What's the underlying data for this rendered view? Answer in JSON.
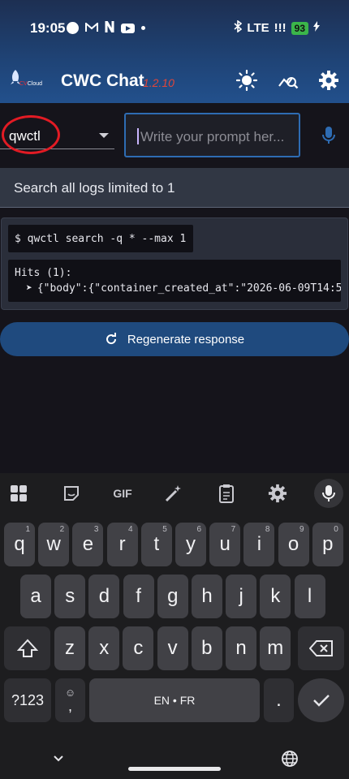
{
  "status": {
    "time": "19:05",
    "network": "LTE",
    "signal_glyph": "!!!",
    "battery": "93",
    "icons": [
      "circle-icon",
      "gmail-icon",
      "netflix-icon",
      "youtube-icon",
      "dot-icon",
      "bluetooth-icon",
      "charging-icon"
    ]
  },
  "appbar": {
    "logo_text_red": "CV",
    "logo_text": "Cloud",
    "title": "CWC Chat",
    "version": "1.2.10",
    "icons": [
      "theme-sun-icon",
      "analytics-icon",
      "settings-gear-icon"
    ]
  },
  "selector": {
    "value": "qwctl"
  },
  "prompt": {
    "placeholder": "Write your prompt her..."
  },
  "suggestion": {
    "text": "Search all logs limited to 1"
  },
  "response": {
    "command": "$ qwctl search -q * --max 1",
    "output_line1": "Hits (1):",
    "output_arrow": "➤",
    "output_line2": "{\"body\":{\"container_created_at\":\"2026-06-09T14:5"
  },
  "regenerate": {
    "label": "Regenerate response"
  },
  "keyboard": {
    "toolbar": [
      "apps-grid-icon",
      "sticker-icon",
      "GIF",
      "magic-wand-icon",
      "clipboard-icon",
      "settings-gear-icon",
      "mic-icon"
    ],
    "gif_label": "GIF",
    "row1": [
      {
        "k": "q",
        "h": "1"
      },
      {
        "k": "w",
        "h": "2"
      },
      {
        "k": "e",
        "h": "3"
      },
      {
        "k": "r",
        "h": "4"
      },
      {
        "k": "t",
        "h": "5"
      },
      {
        "k": "y",
        "h": "6"
      },
      {
        "k": "u",
        "h": "7"
      },
      {
        "k": "i",
        "h": "8"
      },
      {
        "k": "o",
        "h": "9"
      },
      {
        "k": "p",
        "h": "0"
      }
    ],
    "row2": [
      "a",
      "s",
      "d",
      "f",
      "g",
      "h",
      "j",
      "k",
      "l"
    ],
    "row3": [
      "z",
      "x",
      "c",
      "v",
      "b",
      "n",
      "m"
    ],
    "symbols": "?123",
    "emoji_comma": ",",
    "space": "EN • FR",
    "period": "."
  }
}
